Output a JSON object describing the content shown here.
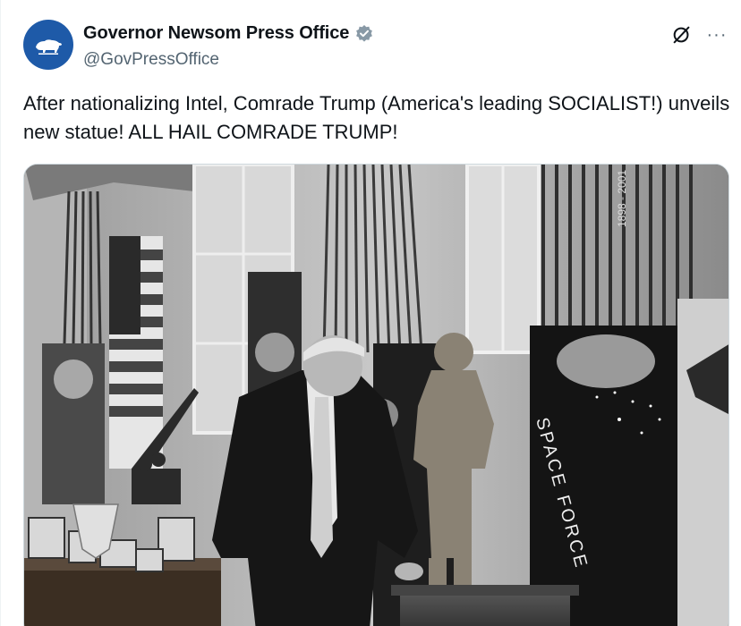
{
  "post": {
    "author": {
      "display_name": "Governor Newsom Press Office",
      "handle": "@GovPressOffice",
      "verified": true,
      "avatar_icon": "california-bear-icon",
      "avatar_color": "#1e5aa8"
    },
    "text": "After nationalizing Intel, Comrade Trump (America's leading SOCIALIST!) unveils new statue! ALL HAIL COMRADE TRUMP!",
    "actions": {
      "grok_icon": "grok-icon",
      "more_label": "···"
    },
    "media": {
      "type": "photo",
      "icon": "photo-image",
      "visible_text": [
        "SPACE FORCE",
        "1898 - 2001"
      ]
    }
  },
  "colors": {
    "verified_blue": "#1d9bf0",
    "text_primary": "#0f1419",
    "text_secondary": "#536471"
  }
}
